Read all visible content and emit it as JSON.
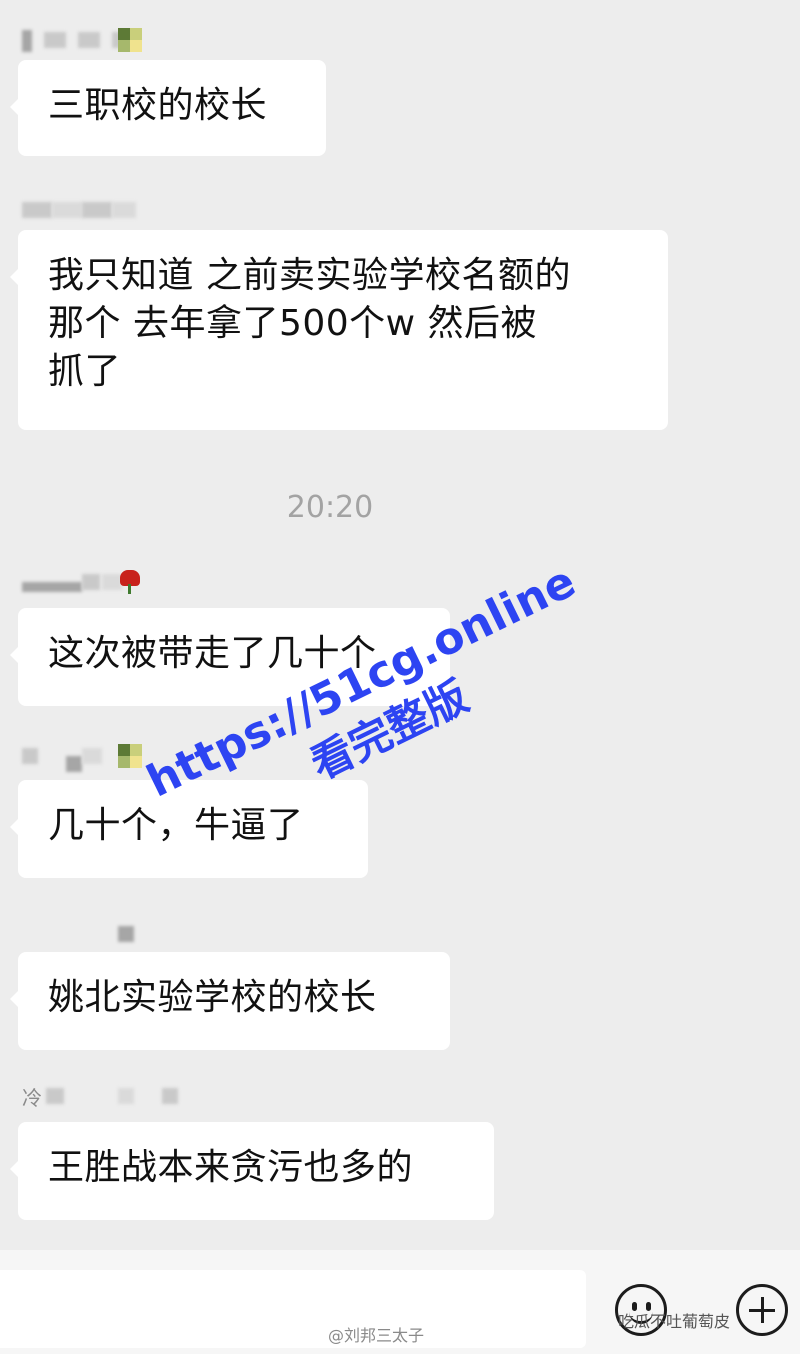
{
  "timestamp": "20:20",
  "messages": [
    {
      "text": "三职校的校长"
    },
    {
      "text": "我只知道 之前卖实验学校名额的"
    },
    {
      "text": "那个 去年拿了500个w 然后被"
    },
    {
      "text": "抓了"
    },
    {
      "text": "这次被带走了几十个"
    },
    {
      "text": "几十个，牛逼了"
    },
    {
      "text": "姚北实验学校的校长"
    },
    {
      "text": "王胜战本来贪污也多的"
    }
  ],
  "sender_fragment": "冷",
  "watermark": {
    "url": "https://51cg.online",
    "sub": "看完整版"
  },
  "credits": {
    "weibo": "@刘邦三太子",
    "right": "吃瓜不吐葡萄皮"
  },
  "icons": {
    "emoji": "smiley-icon",
    "add": "plus-icon"
  },
  "colors": {
    "background": "#ededed",
    "bubble": "#ffffff",
    "watermark": "#2d44f2",
    "timestamp": "#a3a3a3"
  }
}
